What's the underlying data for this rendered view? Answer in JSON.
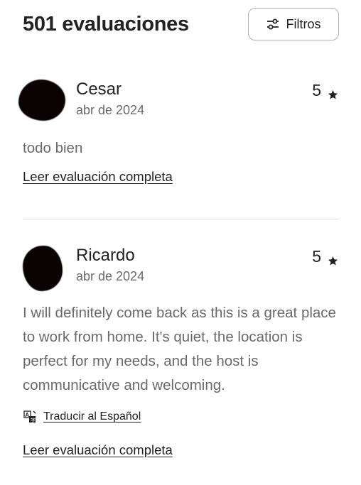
{
  "header": {
    "title": "501 evaluaciones",
    "filters_label": "Filtros",
    "filters_icon": "sliders-icon"
  },
  "reviews": [
    {
      "name": "Cesar",
      "date": "abr de 2024",
      "rating": "5",
      "text": "todo bien",
      "read_more": "Leer evaluación completa"
    },
    {
      "name": "Ricardo",
      "date": "abr de 2024",
      "rating": "5",
      "text": "I will definitely come back as this is a great place to work from home. It's quiet, the location is perfect for my needs, and the host is communicative and welcoming.",
      "translate_label": "Traducir al Español",
      "read_more": "Leer evaluación completa"
    }
  ],
  "colors": {
    "primary_text": "#222222",
    "secondary_text": "#6a6a6a",
    "border": "#b0b0b0",
    "divider": "#dddddd"
  }
}
